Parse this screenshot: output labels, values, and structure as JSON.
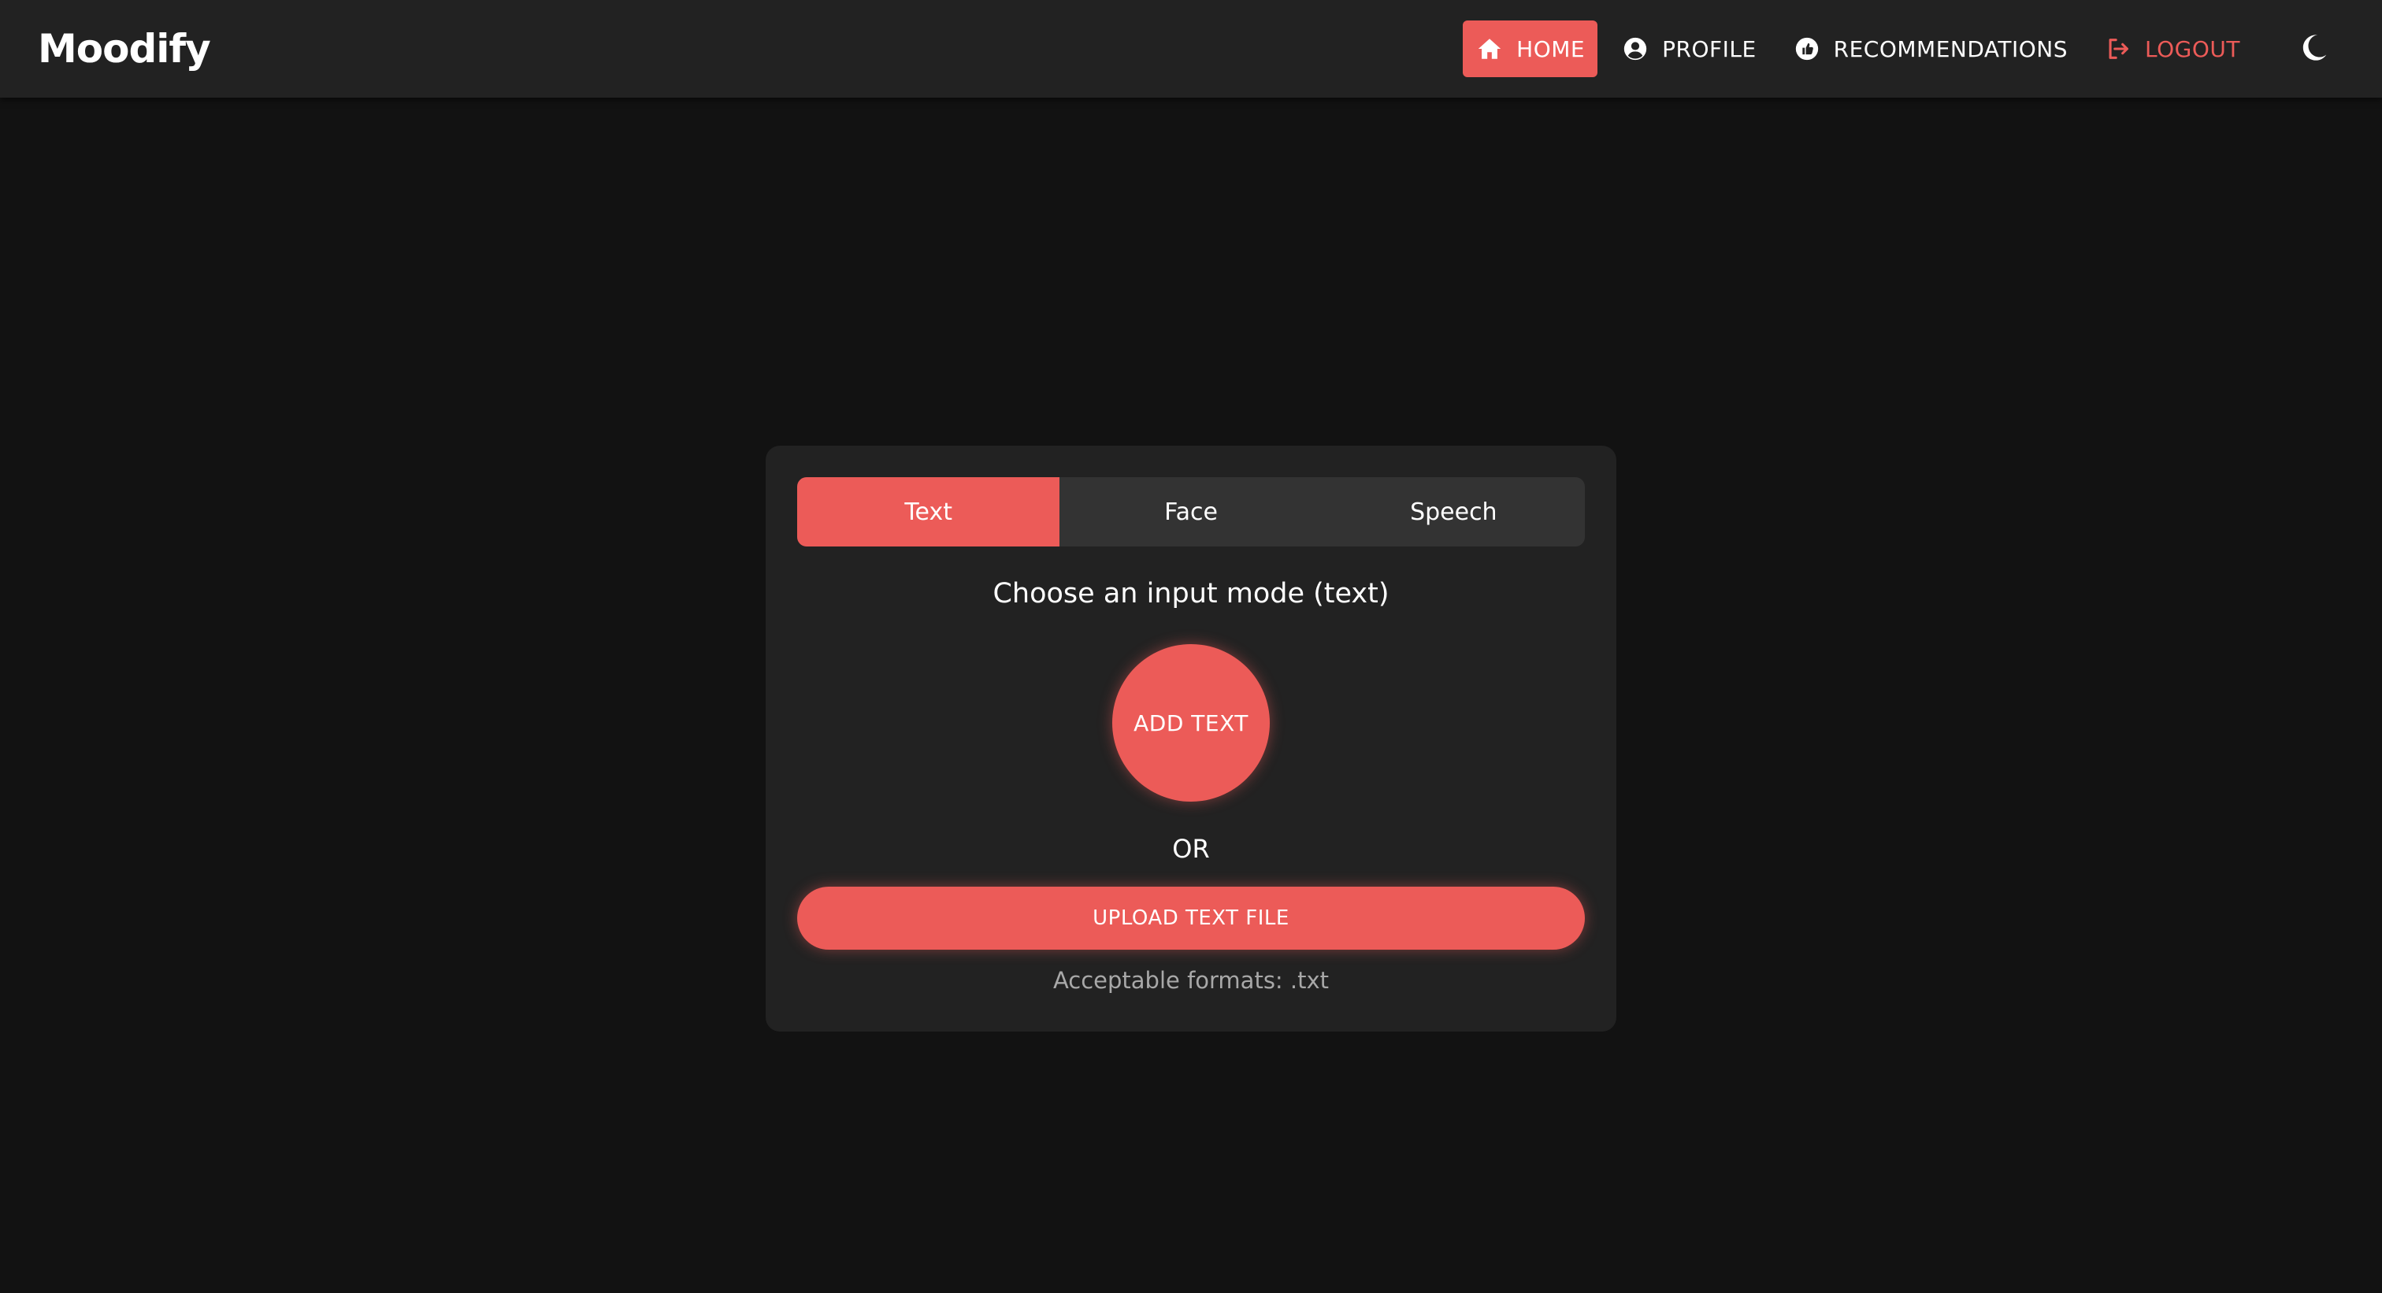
{
  "colors": {
    "accent": "#ec5b58",
    "background": "#121212",
    "surface": "#222222",
    "tab_track": "#333333",
    "muted_text": "#a8a8a8"
  },
  "header": {
    "brand": "Moodify",
    "nav": [
      {
        "label": "HOME",
        "icon": "home-icon",
        "active": true
      },
      {
        "label": "PROFILE",
        "icon": "user-circle-icon",
        "active": false
      },
      {
        "label": "RECOMMENDATIONS",
        "icon": "thumbs-up-icon",
        "active": false
      },
      {
        "label": "LOGOUT",
        "icon": "logout-icon",
        "active": false
      }
    ],
    "theme_toggle_icon": "moon-icon"
  },
  "card": {
    "tabs": [
      {
        "label": "Text",
        "active": true
      },
      {
        "label": "Face",
        "active": false
      },
      {
        "label": "Speech",
        "active": false
      }
    ],
    "mode_title": "Choose an input mode (text)",
    "add_text_label": "ADD TEXT",
    "or_label": "OR",
    "upload_label": "UPLOAD TEXT FILE",
    "formats_note": "Acceptable formats: .txt"
  }
}
